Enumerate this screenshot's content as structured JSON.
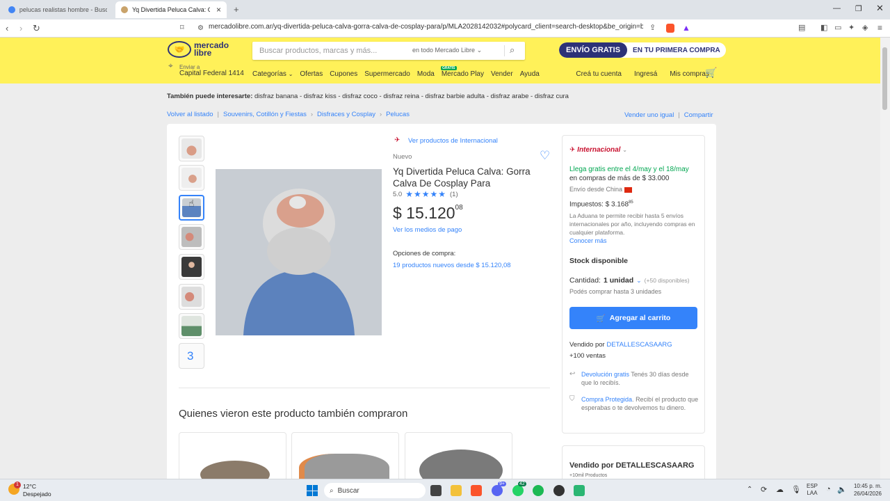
{
  "browser": {
    "tabs": [
      {
        "title": "pelucas realistas hombre - Buscar co"
      },
      {
        "title": "Yq Divertida Peluca Calva: Gorra"
      }
    ],
    "url": "mercadolibre.com.ar/yq-divertida-peluca-calva-gorra-calva-de-cosplay-para/p/MLA2028142032#polycard_client=search-desktop&be_origin=backe...",
    "new_tab": "+",
    "close": "×"
  },
  "header": {
    "logo_line1": "mercado",
    "logo_line2": "libre",
    "search_placeholder": "Buscar productos, marcas y más...",
    "search_scope": "en todo Mercado Libre",
    "promo_a": "ENVÍO GRATIS",
    "promo_b": "EN TU PRIMERA COMPRA",
    "ship_label": "Enviar a",
    "ship_location": "Capital Federal 1414",
    "nav": [
      "Categorías",
      "Ofertas",
      "Cupones",
      "Supermercado",
      "Moda",
      "Mercado Play",
      "Vender",
      "Ayuda"
    ],
    "gratis_badge": "GRATIS",
    "right_nav": [
      "Creá tu cuenta",
      "Ingresá",
      "Mis compras"
    ]
  },
  "interest": {
    "label": "También puede interesarte:",
    "items": "disfraz banana - disfraz kiss - disfraz coco - disfraz reina - disfraz barbie adulta - disfraz arabe - disfraz cura"
  },
  "breadcrumb": {
    "back": "Volver al listado",
    "items": [
      "Souvenirs, Cotillón y Fiestas",
      "Disfraces y Cosplay",
      "Pelucas"
    ],
    "sell_same": "Vender uno igual",
    "share": "Compartir"
  },
  "product": {
    "intl_link": "Ver productos de Internacional",
    "condition": "Nuevo",
    "title": "Yq Divertida Peluca Calva: Gorra Calva De Cosplay Para",
    "rating": "5.0",
    "stars": "★★★★★",
    "reviews": "(1)",
    "price_main": "$ 15.120",
    "price_cents": "08",
    "payment_link": "Ver los medios de pago",
    "options_label": "Opciones de compra:",
    "options_link": "19 productos nuevos desde $ 15.120,08",
    "thumb_count_label": "3"
  },
  "sidebar": {
    "brand": "Internacional",
    "arrival": "Llega gratis entre el 4/may y el 18/may",
    "arrival_min": "en compras de más de $ 33.000",
    "origin": "Envío desde China",
    "taxes": "Impuestos: $ 3.168",
    "taxes_cents": "85",
    "customs": "La Aduana te permite recibir hasta 5 envíos internacionales por año, incluyendo compras en cualquier plataforma.",
    "learn_more": "Conocer más",
    "stock": "Stock disponible",
    "qty_label": "Cantidad:",
    "qty_value": "1 unidad",
    "qty_avail": "(+50 disponibles)",
    "qty_limit": "Podés comprar hasta 3 unidades",
    "add_cart": "Agregar al carrito",
    "sold_by_label": "Vendido por",
    "seller": "DETALLESCASAARG",
    "sales": "+100 ventas",
    "return_link": "Devolución gratis",
    "return_text": "Tenés 30 días desde que lo recibís.",
    "protect_link": "Compra Protegida",
    "protect_text": "Recibí el producto que esperabas o te devolvemos tu dinero.",
    "seller_box": "Vendido por DETALLESCASAARG",
    "seller_sub": "+10mil Productos"
  },
  "related_title": "Quienes vieron este producto también compraron",
  "taskbar": {
    "weather_temp": "12°C",
    "weather_desc": "Despejado",
    "search": "Buscar",
    "lang1": "ESP",
    "lang2": "LAA",
    "time": "10:45 p. m.",
    "date": "26/04/2026",
    "badge_weather": "1",
    "badge_a": "9+",
    "badge_b": "42"
  }
}
